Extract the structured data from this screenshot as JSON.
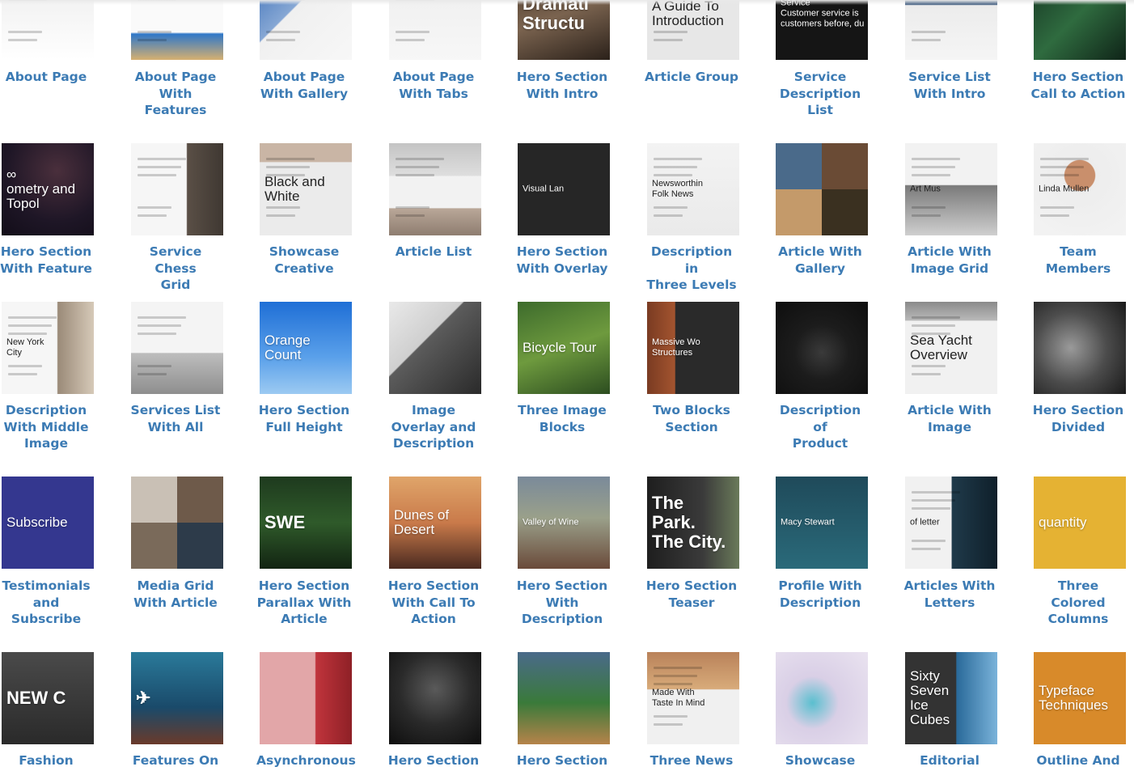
{
  "tiles": [
    {
      "label": "About Page",
      "thumb_text": "",
      "bg": "linear-gradient(180deg,#f4f4f4 0%,#f4f4f4 45%,#ffffff 100%)",
      "style": "dark"
    },
    {
      "label": "About Page\nWith Features",
      "thumb_text": "",
      "bg": "linear-gradient(180deg,#fafafa 0%,#fafafa 70%,#2f77c8 72%,#d6b070 100%)",
      "style": "dark"
    },
    {
      "label": "About Page\nWith Gallery",
      "thumb_text": "",
      "bg": "linear-gradient(135deg,#3b6fb8 0%,#86a7d4 40%,#f0f0f0 41%,#f7f7f7 100%)",
      "style": "dark"
    },
    {
      "label": "About Page\nWith Tabs",
      "thumb_text": "",
      "bg": "linear-gradient(180deg,#ededed 0%,#f7f7f7 100%)",
      "style": "dark"
    },
    {
      "label": "Hero Section\nWith Intro",
      "thumb_text": "Dramati\nStructu",
      "bg": "linear-gradient(160deg,#4b3a2c 0%,#7a634f 50%,#2b211a 100%)",
      "style": "big"
    },
    {
      "label": "Article Group",
      "thumb_text": "A Guide To\nIntroduction",
      "bg": "linear-gradient(180deg,#6b4c36 0%,#6b4c36 10%,#e7e7e7 11%,#e7e7e7 100%)",
      "style": "dark mid"
    },
    {
      "label": "Service\nDescription\nList",
      "thumb_text": "Service\nCustomer service is\ncustomers before, du",
      "bg": "#151515",
      "style": "small"
    },
    {
      "label": "Service List\nWith Intro",
      "thumb_text": "",
      "bg": "linear-gradient(180deg,#2e4f73 0%,#405c7f 40%,#ececec 41%,#f5f5f5 100%)",
      "style": "dark"
    },
    {
      "label": "Hero Section\nCall to Action",
      "thumb_text": "",
      "bg": "linear-gradient(135deg,#153322 0%,#2f6b3f 50%,#0f2418 100%)",
      "style": ""
    },
    {
      "label": "Hero Section\nWith Feature",
      "thumb_text": "∞\nometry and Topol",
      "bg": "radial-gradient(circle at 60% 30%,#4a2f3c 0%,#1e1626 60%,#120d18 100%)",
      "style": "mid"
    },
    {
      "label": "Service Chess\nGrid",
      "thumb_text": "",
      "bg": "linear-gradient(90deg,#f6f6f6 0%,#f6f6f6 60%,#5a4f46 61%,#3f3832 100%)",
      "style": "dark"
    },
    {
      "label": "Showcase\nCreative",
      "thumb_text": "Black and\nWhite",
      "bg": "linear-gradient(180deg,#c9b5a5 0%,#c9b5a5 20%,#ebebeb 21%,#ebebeb 100%)",
      "style": "dark mid"
    },
    {
      "label": "Article List",
      "thumb_text": "",
      "bg": "linear-gradient(180deg,#c4c4c4 0%,#dedede 35%,#f2f2f2 36%,#f2f2f2 70%,#b9a798 71%,#8e7d70 100%)",
      "style": "dark"
    },
    {
      "label": "Hero Section\nWith Overlay",
      "thumb_text": "Visual Lan",
      "bg": "#262626",
      "style": "small"
    },
    {
      "label": "Description in\nThree Levels",
      "thumb_text": "Newsworthin\nFolk News",
      "bg": "linear-gradient(180deg,#f3f3f3 0%,#eaeaea 100%)",
      "style": "dark small"
    },
    {
      "label": "Article With\nGallery",
      "thumb_text": "",
      "bg": "conic-gradient(#6a4b35 0 25%,#3a3020 0 50%,#c49a6a 0 75%,#4a6a8a 0 100%)",
      "style": ""
    },
    {
      "label": "Article With\nImage Grid",
      "thumb_text": "Art Mus",
      "bg": "linear-gradient(180deg,#f2f2f2 0%,#f2f2f2 45%,#7a7a7a 46%,#cfcfcf 100%)",
      "style": "dark small"
    },
    {
      "label": "Team\nMembers",
      "thumb_text": "Linda Mullen",
      "bg": "radial-gradient(circle at 50% 35%,#c98f6c 0%,#c98f6c 20%,#ededed 21%,#f3f3f3 100%)",
      "style": "dark small"
    },
    {
      "label": "Description\nWith Middle\nImage",
      "thumb_text": "New York\nCity",
      "bg": "linear-gradient(90deg,#f6f6f6 0%,#f6f6f6 60%,#9a8a78 61%,#d6c9b8 100%)",
      "style": "dark small"
    },
    {
      "label": "Services List\nWith All",
      "thumb_text": "",
      "bg": "linear-gradient(180deg,#f4f4f4 0%,#f4f4f4 55%,#bdbdbd 56%,#8e8e8e 100%)",
      "style": "dark"
    },
    {
      "label": "Hero Section\nFull Height",
      "thumb_text": "Orange Count",
      "bg": "linear-gradient(180deg,#1f6fd6 0%,#5aa0ea 60%,#9ccaf2 100%)",
      "style": "mid"
    },
    {
      "label": "Image\nOverlay and\nDescription",
      "thumb_text": "",
      "bg": "linear-gradient(135deg,#e9e9e9 0%,#cfcfcf 40%,#5c5c5c 41%,#2a2a2a 100%)",
      "style": ""
    },
    {
      "label": "Three Image\nBlocks",
      "thumb_text": "Bicycle Tour",
      "bg": "linear-gradient(160deg,#3d6b2c 0%,#6e9a3e 50%,#2c4d20 100%)",
      "style": "mid"
    },
    {
      "label": "Two Blocks\nSection",
      "thumb_text": "Massive Wo\nStructures",
      "bg": "linear-gradient(90deg,#7a3b22 0%,#a3542f 30%,#2a2a2a 31%,#2a2a2a 100%)",
      "style": "small"
    },
    {
      "label": "Description of\nProduct",
      "thumb_text": "",
      "bg": "radial-gradient(circle at 50% 55%,#3a3a3a 0%,#1c1c1c 40%,#0e0e0e 100%)",
      "style": ""
    },
    {
      "label": "Article With\nImage",
      "thumb_text": "Sea Yacht\nOverview",
      "bg": "linear-gradient(180deg,#8a8a8a 0%,#b9b9b9 20%,#f1f1f1 21%,#f1f1f1 100%)",
      "style": "dark mid"
    },
    {
      "label": "Hero Section\nDivided",
      "thumb_text": "",
      "bg": "radial-gradient(circle at 40% 50%,#9a9a9a 0%,#4c4c4c 50%,#1a1a1a 100%)",
      "style": ""
    },
    {
      "label": "Testimonials\nand Subscribe",
      "thumb_text": "Subscribe",
      "bg": "#34378f",
      "style": "mid"
    },
    {
      "label": "Media Grid\nWith Article",
      "thumb_text": "",
      "bg": "conic-gradient(#6e5a4a 0 25%,#2d3b4a 0 50%,#7a6a5a 0 75%,#c9c0b5 0 100%)",
      "style": ""
    },
    {
      "label": "Hero Section\nParallax With\nArticle",
      "thumb_text": "SWE",
      "bg": "linear-gradient(180deg,#1e3a1e 0%,#2f5a2a 50%,#122412 100%)",
      "style": "big"
    },
    {
      "label": "Hero Section\nWith Call To\nAction",
      "thumb_text": "Dunes of\nDesert",
      "bg": "linear-gradient(180deg,#e0a56a 0%,#c97a4a 50%,#4a2a20 100%)",
      "style": "mid"
    },
    {
      "label": "Hero Section\nWith\nDescription",
      "thumb_text": "Valley of Wine",
      "bg": "linear-gradient(180deg,#7a8a9a 0%,#9aa08a 45%,#6a4a3a 100%)",
      "style": "small"
    },
    {
      "label": "Hero Section\nTeaser",
      "thumb_text": "The\nPark.\nThe City.",
      "bg": "linear-gradient(90deg,#1e1e1e 0%,#3a3a3a 60%,#6a7a5a 100%)",
      "style": "big"
    },
    {
      "label": "Profile With\nDescription",
      "thumb_text": "Macy Stewart",
      "bg": "linear-gradient(180deg,#1f4a5a 0%,#2a6a7a 100%)",
      "style": "small"
    },
    {
      "label": "Articles With\nLetters",
      "thumb_text": "of letter",
      "bg": "linear-gradient(90deg,#f1f1f1 0%,#f1f1f1 50%,#1f3a4a 51%,#0f1f2a 100%)",
      "style": "dark small"
    },
    {
      "label": "Three Colored\nColumns",
      "thumb_text": "quantity",
      "bg": "#e5b233",
      "style": "mid"
    },
    {
      "label": "Fashion",
      "thumb_text": "NEW C",
      "bg": "linear-gradient(180deg,#4a4a4a 0%,#2a2a2a 100%)",
      "style": "big"
    },
    {
      "label": "Features On",
      "thumb_text": "✈",
      "bg": "linear-gradient(180deg,#2a7a9a 0%,#1a4a6a 60%,#6a3a2a 100%)",
      "style": "big"
    },
    {
      "label": "Asynchronous",
      "thumb_text": "",
      "bg": "linear-gradient(90deg,#e2a6a8 0%,#e2a6a8 60%,#c0343c 61%,#8e2026 100%)",
      "style": ""
    },
    {
      "label": "Hero Section",
      "thumb_text": "",
      "bg": "radial-gradient(circle at 50% 40%,#5a5a5a 0%,#2a2a2a 50%,#0e0e0e 100%)",
      "style": ""
    },
    {
      "label": "Hero Section",
      "thumb_text": "",
      "bg": "linear-gradient(180deg,#4a6a8a 0%,#3a7a3a 55%,#b6834a 100%)",
      "style": ""
    },
    {
      "label": "Three News",
      "thumb_text": "Made With\nTaste In Mind",
      "bg": "linear-gradient(180deg,#b9825a 0%,#d8ab7a 40%,#f0f0f0 41%,#f0f0f0 100%)",
      "style": "dark small"
    },
    {
      "label": "Showcase",
      "thumb_text": "",
      "bg": "radial-gradient(circle at 40% 55%,#5abfcf 0%,#d9cfe6 35%,#eae3f0 100%)",
      "style": ""
    },
    {
      "label": "Editorial",
      "thumb_text": "Sixty\nSeven\nIce\nCubes",
      "bg": "linear-gradient(90deg,#333333 0%,#333333 55%,#2a6a9a 56%,#7ab3da 100%)",
      "style": "mid"
    },
    {
      "label": "Outline And",
      "thumb_text": "Typeface\nTechniques",
      "bg": "#d88a2a",
      "style": "mid"
    }
  ]
}
